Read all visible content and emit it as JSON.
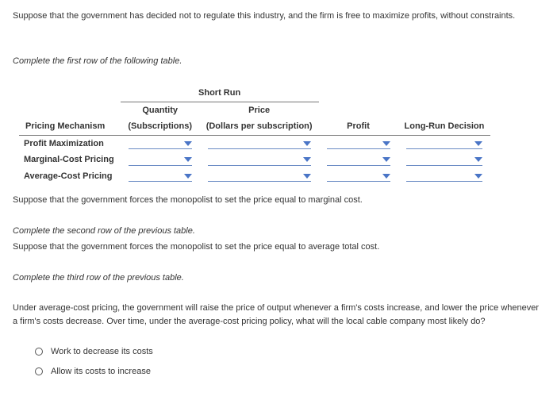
{
  "intro": "Suppose that the government has decided not to regulate this industry, and the firm is free to maximize profits, without constraints.",
  "instr1": "Complete the first row of the following table.",
  "table": {
    "short_run": "Short Run",
    "quantity_hdr1": "Quantity",
    "quantity_hdr2": "(Subscriptions)",
    "price_hdr1": "Price",
    "price_hdr2": "(Dollars per subscription)",
    "mech_hdr": "Pricing Mechanism",
    "profit_hdr": "Profit",
    "long_run_hdr": "Long-Run Decision",
    "rows": [
      "Profit Maximization",
      "Marginal-Cost Pricing",
      "Average-Cost Pricing"
    ]
  },
  "p_after_table": "Suppose that the government forces the monopolist to set the price equal to marginal cost.",
  "instr2": "Complete the second row of the previous table.",
  "p_after_instr2": "Suppose that the government forces the monopolist to set the price equal to average total cost.",
  "instr3": "Complete the third row of the previous table.",
  "under_avg": "Under average-cost pricing, the government will raise the price of output whenever a firm's costs increase, and lower the price whenever a firm's costs decrease. Over time, under the average-cost pricing policy, what will the local cable company most likely do?",
  "options": [
    "Work to decrease its costs",
    "Allow its costs to increase"
  ]
}
